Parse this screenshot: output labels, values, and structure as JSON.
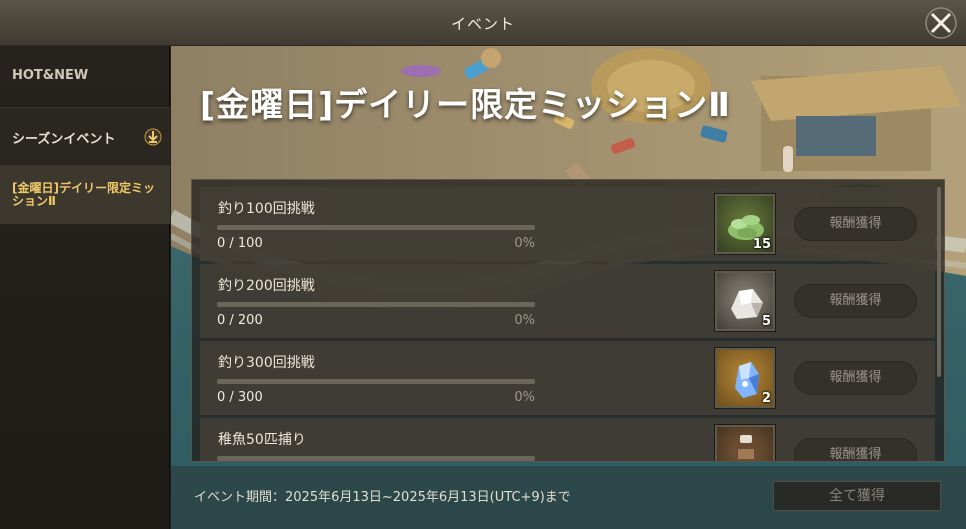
{
  "window": {
    "title": "イベント"
  },
  "sidebar": {
    "items": [
      {
        "label": "HOT&NEW"
      },
      {
        "label": "シーズンイベント"
      },
      {
        "label": "[金曜日]デイリー限定ミッションⅡ"
      }
    ]
  },
  "banner": {
    "title": "[金曜日]デイリー限定ミッションⅡ"
  },
  "missions": [
    {
      "name": "釣り100回挑戦",
      "count": "0 / 100",
      "percent": "0%",
      "progress": 0,
      "reward_qty": "15",
      "reward_icon": "green-coin-pile-icon",
      "claim_label": "報酬獲得"
    },
    {
      "name": "釣り200回挑戦",
      "count": "0 / 200",
      "percent": "0%",
      "progress": 0,
      "reward_qty": "5",
      "reward_icon": "white-ore-icon",
      "claim_label": "報酬獲得"
    },
    {
      "name": "釣り300回挑戦",
      "count": "0 / 300",
      "percent": "0%",
      "progress": 0,
      "reward_qty": "2",
      "reward_icon": "blue-crystal-icon",
      "claim_label": "報酬獲得"
    },
    {
      "name": "稚魚50匹捕り",
      "count": "",
      "percent": "",
      "progress": 0,
      "reward_qty": "",
      "reward_icon": "bottle-icon",
      "claim_label": "報酬獲得"
    }
  ],
  "footer": {
    "period": "イベント期間：2025年6月13日~2025年6月13日(UTC+9)まで",
    "claim_all_label": "全て獲得"
  },
  "colors": {
    "accent": "#f0c868",
    "panel": "#423f37"
  }
}
